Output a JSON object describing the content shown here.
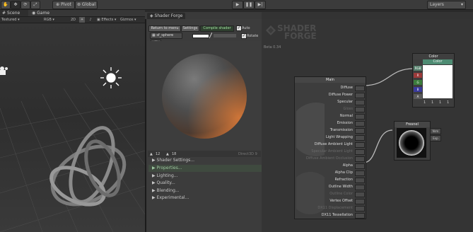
{
  "toolbar": {
    "pivot_label": "Pivot",
    "global_label": "Global",
    "layers_label": "Layers"
  },
  "tabs": {
    "scene_label": "Scene",
    "game_label": "Game"
  },
  "scenebar": {
    "shading_mode": "Textured",
    "render_mode": "RGB",
    "mode_2d": "2D",
    "effects_label": "Effects",
    "gizmos_label": "Gizmos"
  },
  "shader_forge": {
    "title": "Shader Forge",
    "return_label": "Return to menu",
    "settings_label": "Settings",
    "compile_label": "Compile shader",
    "auto_label": "Auto",
    "mesh_field": "sf_sphere",
    "rotate_label": "Rotate",
    "version_logo_top": "SHADER",
    "version_logo_bottom": "FORGE",
    "version": "Beta 0.34",
    "stats": {
      "vertex_count": "12",
      "fragment_count": "18",
      "api_label": "Direct3D 9"
    },
    "menu": [
      {
        "label": "Shader Settings..."
      },
      {
        "label": "Properties..."
      },
      {
        "label": "Lighting..."
      },
      {
        "label": "Quality..."
      },
      {
        "label": "Blending..."
      },
      {
        "label": "Experimental..."
      }
    ]
  },
  "nodes": {
    "main": {
      "title": "Main",
      "inputs": [
        {
          "label": "Diffuse",
          "enabled": true
        },
        {
          "label": "Diffuse Power",
          "enabled": true
        },
        {
          "label": "Specular",
          "enabled": true
        },
        {
          "label": "Gloss",
          "enabled": false
        },
        {
          "label": "Normal",
          "enabled": true
        },
        {
          "label": "Emission",
          "enabled": true
        },
        {
          "label": "Transmission",
          "enabled": true
        },
        {
          "label": "Light Wrapping",
          "enabled": true
        },
        {
          "label": "Diffuse Ambient Light",
          "enabled": true
        },
        {
          "label": "Specular Ambient Light",
          "enabled": false
        },
        {
          "label": "Diffuse Ambient Occlusion",
          "enabled": false
        },
        {
          "label": "Alpha",
          "enabled": true
        },
        {
          "label": "Alpha Clip",
          "enabled": true
        },
        {
          "label": "Refraction",
          "enabled": true
        },
        {
          "label": "Outline Width",
          "enabled": true
        },
        {
          "label": "Outline Color",
          "enabled": false
        },
        {
          "label": "Vertex Offset",
          "enabled": true
        },
        {
          "label": "DX11 Displacement",
          "enabled": false
        },
        {
          "label": "DX11 Tessellation",
          "enabled": true
        }
      ]
    },
    "color": {
      "title": "Color",
      "subtitle": "Color",
      "outputs": [
        "RGB",
        "R",
        "G",
        "B",
        "A"
      ],
      "swatch": "#ffffff",
      "values": [
        "1",
        "1",
        "1",
        "1"
      ]
    },
    "fresnel": {
      "title": "Fresnel",
      "inputs": [
        "Nrm",
        "Exp"
      ]
    }
  }
}
